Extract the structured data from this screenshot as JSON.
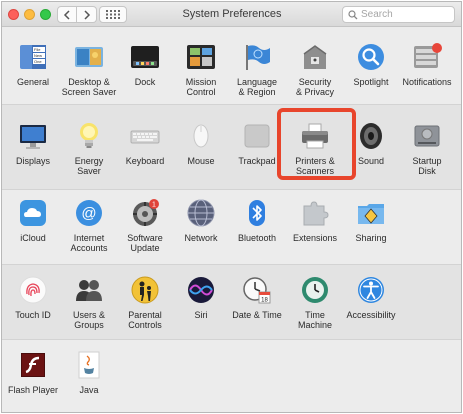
{
  "window": {
    "title": "System Preferences",
    "search_placeholder": "Search"
  },
  "sections": [
    {
      "items": [
        {
          "label": "General",
          "icon": "general-icon"
        },
        {
          "label": "Desktop &\nScreen Saver",
          "icon": "desktop-screensaver-icon"
        },
        {
          "label": "Dock",
          "icon": "dock-icon"
        },
        {
          "label": "Mission\nControl",
          "icon": "mission-control-icon"
        },
        {
          "label": "Language\n& Region",
          "icon": "language-region-icon"
        },
        {
          "label": "Security\n& Privacy",
          "icon": "security-privacy-icon"
        },
        {
          "label": "Spotlight",
          "icon": "spotlight-icon"
        },
        {
          "label": "Notifications",
          "icon": "notifications-icon"
        }
      ]
    },
    {
      "items": [
        {
          "label": "Displays",
          "icon": "displays-icon"
        },
        {
          "label": "Energy\nSaver",
          "icon": "energy-saver-icon"
        },
        {
          "label": "Keyboard",
          "icon": "keyboard-icon"
        },
        {
          "label": "Mouse",
          "icon": "mouse-icon"
        },
        {
          "label": "Trackpad",
          "icon": "trackpad-icon"
        },
        {
          "label": "Printers &\nScanners",
          "icon": "printers-scanners-icon"
        },
        {
          "label": "Sound",
          "icon": "sound-icon"
        },
        {
          "label": "Startup\nDisk",
          "icon": "startup-disk-icon"
        }
      ]
    },
    {
      "items": [
        {
          "label": "iCloud",
          "icon": "icloud-icon"
        },
        {
          "label": "Internet\nAccounts",
          "icon": "internet-accounts-icon"
        },
        {
          "label": "Software\nUpdate",
          "icon": "software-update-icon",
          "badge": "1"
        },
        {
          "label": "Network",
          "icon": "network-icon"
        },
        {
          "label": "Bluetooth",
          "icon": "bluetooth-icon"
        },
        {
          "label": "Extensions",
          "icon": "extensions-icon"
        },
        {
          "label": "Sharing",
          "icon": "sharing-icon"
        }
      ]
    },
    {
      "items": [
        {
          "label": "Touch ID",
          "icon": "touch-id-icon"
        },
        {
          "label": "Users &\nGroups",
          "icon": "users-groups-icon"
        },
        {
          "label": "Parental\nControls",
          "icon": "parental-controls-icon"
        },
        {
          "label": "Siri",
          "icon": "siri-icon"
        },
        {
          "label": "Date & Time",
          "icon": "date-time-icon",
          "calendar_day": "18"
        },
        {
          "label": "Time\nMachine",
          "icon": "time-machine-icon"
        },
        {
          "label": "Accessibility",
          "icon": "accessibility-icon"
        }
      ]
    },
    {
      "items": [
        {
          "label": "Flash Player",
          "icon": "flash-player-icon"
        },
        {
          "label": "Java",
          "icon": "java-icon"
        }
      ]
    }
  ],
  "general_icon_text": [
    "File",
    "New",
    "One"
  ],
  "highlight": {
    "target": "Printers & Scanners",
    "color": "#e8452c"
  }
}
